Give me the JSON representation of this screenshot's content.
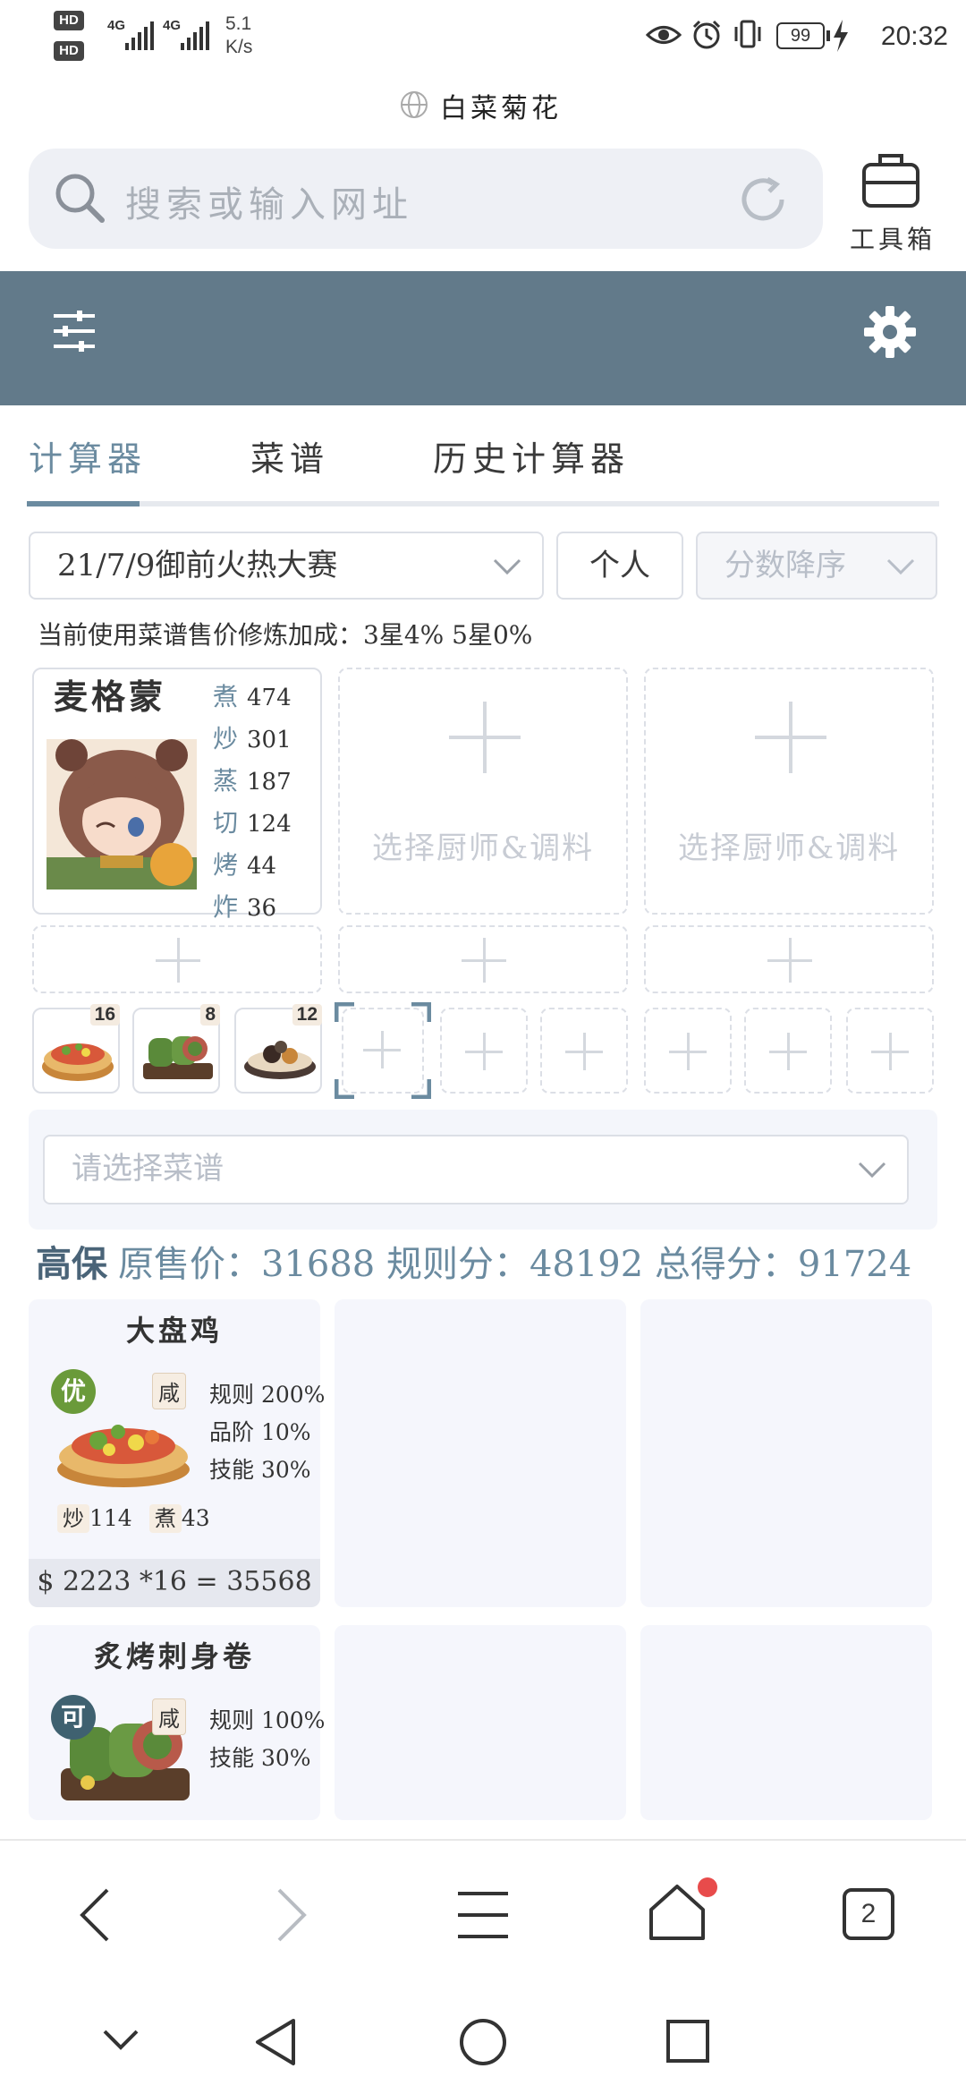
{
  "status_bar": {
    "hd1": "HD 1",
    "hd2": "HD 2",
    "sig1": "4G",
    "sig2": "4G",
    "speed_value": "5.1",
    "speed_unit": "K/s",
    "battery": "99",
    "time": "20:32"
  },
  "browser": {
    "page_title": "白菜菊花",
    "search_placeholder": "搜索或输入网址",
    "toolbox_label": "工具箱",
    "tab_count": "2"
  },
  "tabs": [
    {
      "label": "计算器",
      "active": true
    },
    {
      "label": "菜谱",
      "active": false
    },
    {
      "label": "历史计算器",
      "active": false
    }
  ],
  "filters": {
    "event": "21/7/9御前火热大赛",
    "mode": "个人",
    "sort": "分数降序"
  },
  "bonus_text": "当前使用菜谱售价修炼加成：3星4% 5星0%",
  "chef": {
    "name": "麦格蒙",
    "skills": [
      {
        "key": "煮",
        "value": "474"
      },
      {
        "key": "炒",
        "value": "301"
      },
      {
        "key": "蒸",
        "value": "187"
      },
      {
        "key": "切",
        "value": "124"
      },
      {
        "key": "烤",
        "value": "44"
      },
      {
        "key": "炸",
        "value": "36"
      }
    ]
  },
  "empty_slot_label": "选择厨师&调料",
  "dish_counts": [
    "16",
    "8",
    "12"
  ],
  "recipe_select_placeholder": "请选择菜谱",
  "summary": {
    "level": "高保",
    "text": "原售价：31688 规则分：48192 总得分：91724"
  },
  "results": [
    {
      "name": "大盘鸡",
      "grade": "优",
      "grade_color": "#6a9a3a",
      "flavor": "咸",
      "stats": [
        "规则 200%",
        "品阶 10%",
        "技能 30%"
      ],
      "req1_key": "炒",
      "req1_val": "114",
      "req2_key": "煮",
      "req2_val": "43",
      "price_line": "$ 2223 *16  = 35568"
    },
    {
      "name": "炙烤刺身卷",
      "grade": "可",
      "grade_color": "#3f6170",
      "flavor": "咸",
      "stats": [
        "规则 100%",
        "技能 30%"
      ]
    }
  ],
  "colors": {
    "appbar": "#627a8a",
    "accent": "#6b8ba0",
    "notification_dot": "#e84b4b"
  }
}
